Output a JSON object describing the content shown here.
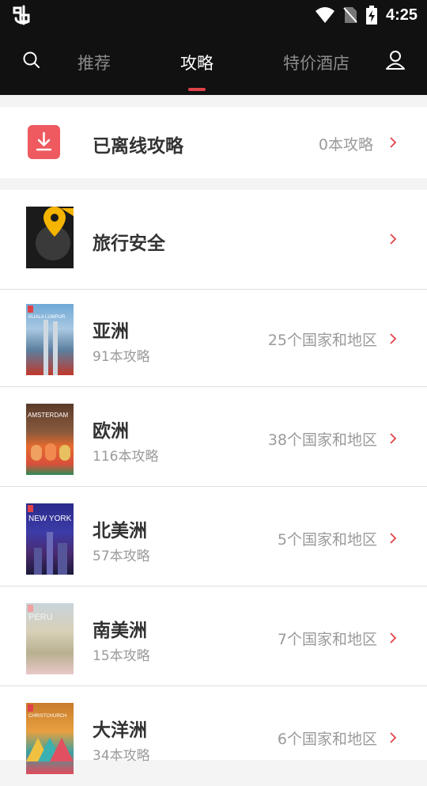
{
  "status": {
    "time": "4:25"
  },
  "nav": {
    "tabs": [
      {
        "label": "推荐"
      },
      {
        "label": "攻略"
      },
      {
        "label": "特价酒店"
      }
    ]
  },
  "offline": {
    "title": "已离线攻略",
    "count": "0本攻略"
  },
  "safety": {
    "title": "旅行安全"
  },
  "regions": [
    {
      "title": "亚洲",
      "sub": "91本攻略",
      "count": "25个国家和地区",
      "cover_text": "KUALA LUMPUR"
    },
    {
      "title": "欧洲",
      "sub": "116本攻略",
      "count": "38个国家和地区",
      "cover_text": "AMSTERDAM"
    },
    {
      "title": "北美洲",
      "sub": "57本攻略",
      "count": "5个国家和地区",
      "cover_text": "NEW YORK"
    },
    {
      "title": "南美洲",
      "sub": "15本攻略",
      "count": "7个国家和地区",
      "cover_text": "PERU"
    },
    {
      "title": "大洋洲",
      "sub": "34本攻略",
      "count": "6个国家和地区",
      "cover_text": "CHRISTCHURCH"
    }
  ],
  "colors": {
    "accent": "#e0424a",
    "offline_icon": "#ee5a5f",
    "navbar": "#111111"
  }
}
